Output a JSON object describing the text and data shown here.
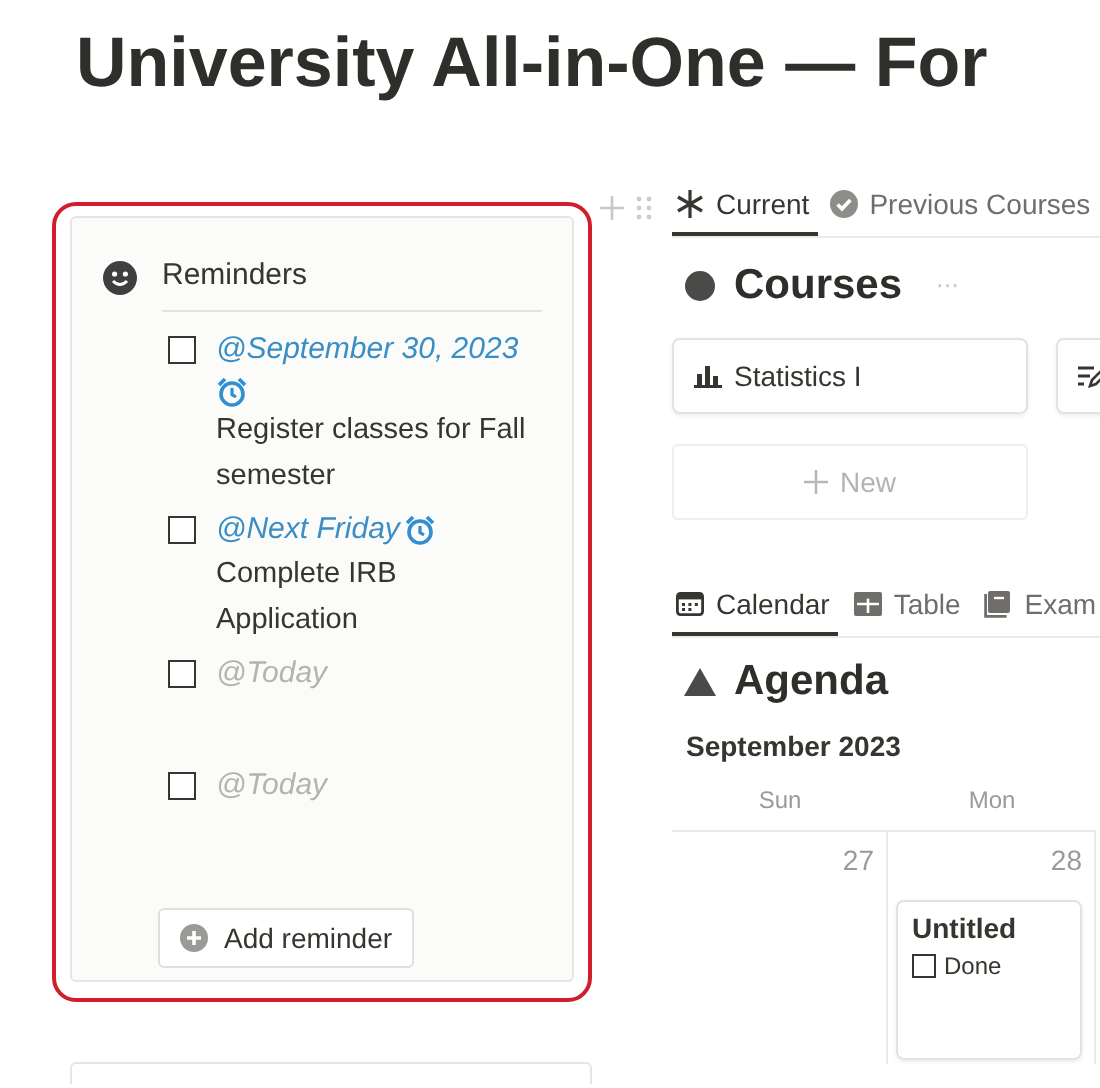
{
  "page": {
    "title": "University All-in-One — For"
  },
  "reminders": {
    "heading": "Reminders",
    "items": [
      {
        "date": "@September 30, 2023",
        "muted": false,
        "alarm": true,
        "task": "Register classes for Fall semester",
        "checked": false
      },
      {
        "date": "@Next Friday",
        "muted": false,
        "alarm": true,
        "task": "Complete IRB Application",
        "checked": false
      },
      {
        "date": "@Today",
        "muted": true,
        "alarm": false,
        "checked": false
      },
      {
        "date": "@Today",
        "muted": true,
        "alarm": false,
        "checked": false
      }
    ],
    "add_button": "Add reminder"
  },
  "course_tabs": [
    {
      "label": "Current",
      "selected": true
    },
    {
      "label": "Previous Courses",
      "selected": false
    }
  ],
  "courses": {
    "heading": "Courses",
    "more_label": "···",
    "cards": [
      {
        "kind": "chart",
        "title": "Statistics I"
      },
      {
        "kind": "list"
      }
    ],
    "new_button": "New"
  },
  "view_tabs": [
    {
      "label": "Calendar",
      "selected": true
    },
    {
      "label": "Table",
      "selected": false
    },
    {
      "label": "Exam",
      "selected": false
    }
  ],
  "agenda": {
    "heading": "Agenda",
    "month": "September 2023",
    "days": [
      {
        "weekday": "Sun",
        "date": "27"
      },
      {
        "weekday": "Mon",
        "date": "28",
        "events": [
          {
            "title": "Untitled",
            "checkbox_label": "Done",
            "checked": false
          }
        ]
      }
    ]
  }
}
